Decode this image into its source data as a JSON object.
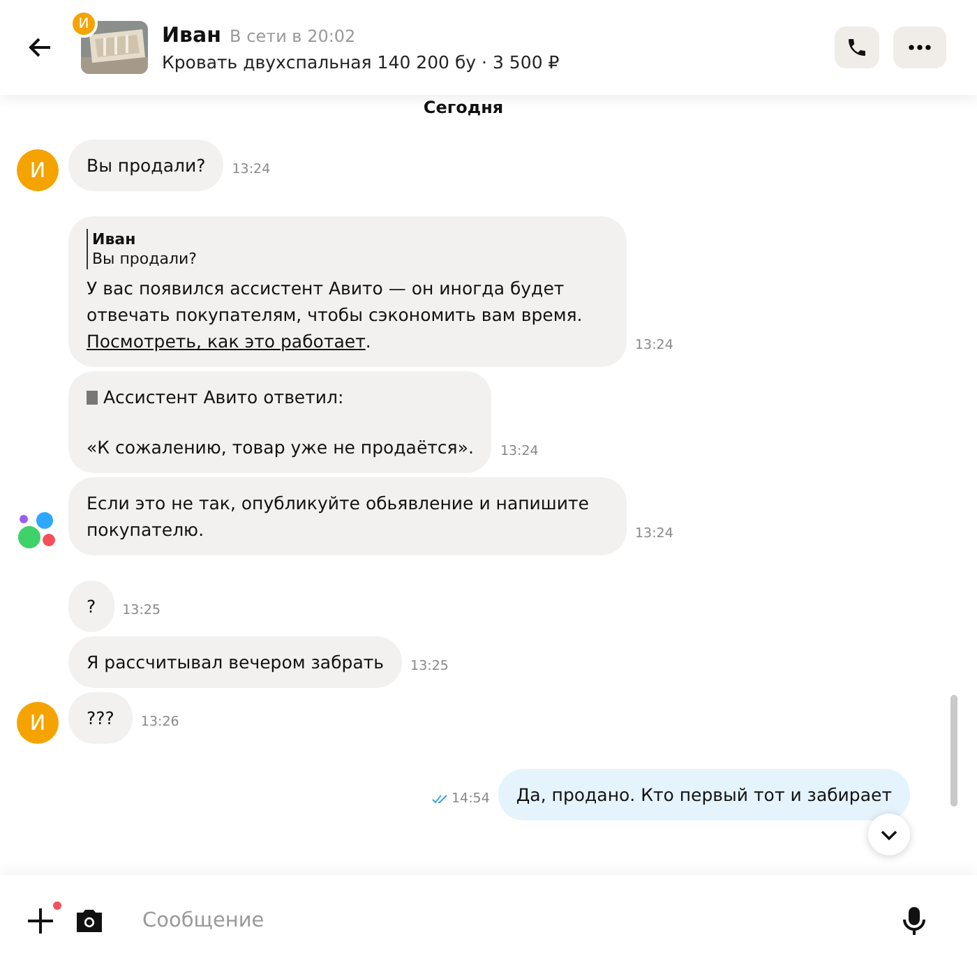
{
  "header": {
    "avatar_letter": "И",
    "name": "Иван",
    "status": "В сети в 20:02",
    "listing": "Кровать двухспальная 140 200 бу · 3 500 ₽"
  },
  "date_label": "Сегодня",
  "groups": [
    {
      "outgoing": false,
      "avatar": {
        "kind": "letter",
        "letter": "И"
      },
      "messages": [
        {
          "kind": "text",
          "text": "Вы продали?",
          "time": "13:24"
        }
      ]
    },
    {
      "outgoing": false,
      "avatar": {
        "kind": "logo"
      },
      "messages": [
        {
          "kind": "notice",
          "quote_author": "Иван",
          "quote_text": "Вы продали?",
          "text": "У вас появился ассистент Авито — он иногда будет отвечать покупателям, чтобы сэкономить вам время.",
          "link": "Посмотреть, как это работает",
          "after_link": ".",
          "time": "13:24"
        },
        {
          "kind": "assistant",
          "title": "Ассистент Авито ответил:",
          "text": "«К сожалению, товар уже не продаётся».",
          "time": "13:24"
        },
        {
          "kind": "text",
          "text": "Если это не так, опубликуйте обьявление и напишите покупателю.",
          "time": "13:24"
        }
      ]
    },
    {
      "outgoing": false,
      "avatar": {
        "kind": "letter",
        "letter": "И"
      },
      "messages": [
        {
          "kind": "text",
          "text": "?",
          "time": "13:25"
        },
        {
          "kind": "text",
          "text": "Я рассчитывал вечером забрать",
          "time": "13:25"
        },
        {
          "kind": "text",
          "text": "???",
          "time": "13:26"
        }
      ]
    },
    {
      "outgoing": true,
      "messages": [
        {
          "kind": "text",
          "text": "Да, продано. Кто первый тот и забирает",
          "time": "14:54",
          "read": true
        }
      ]
    }
  ],
  "composer": {
    "placeholder": "Сообщение",
    "attach_badge": true
  }
}
